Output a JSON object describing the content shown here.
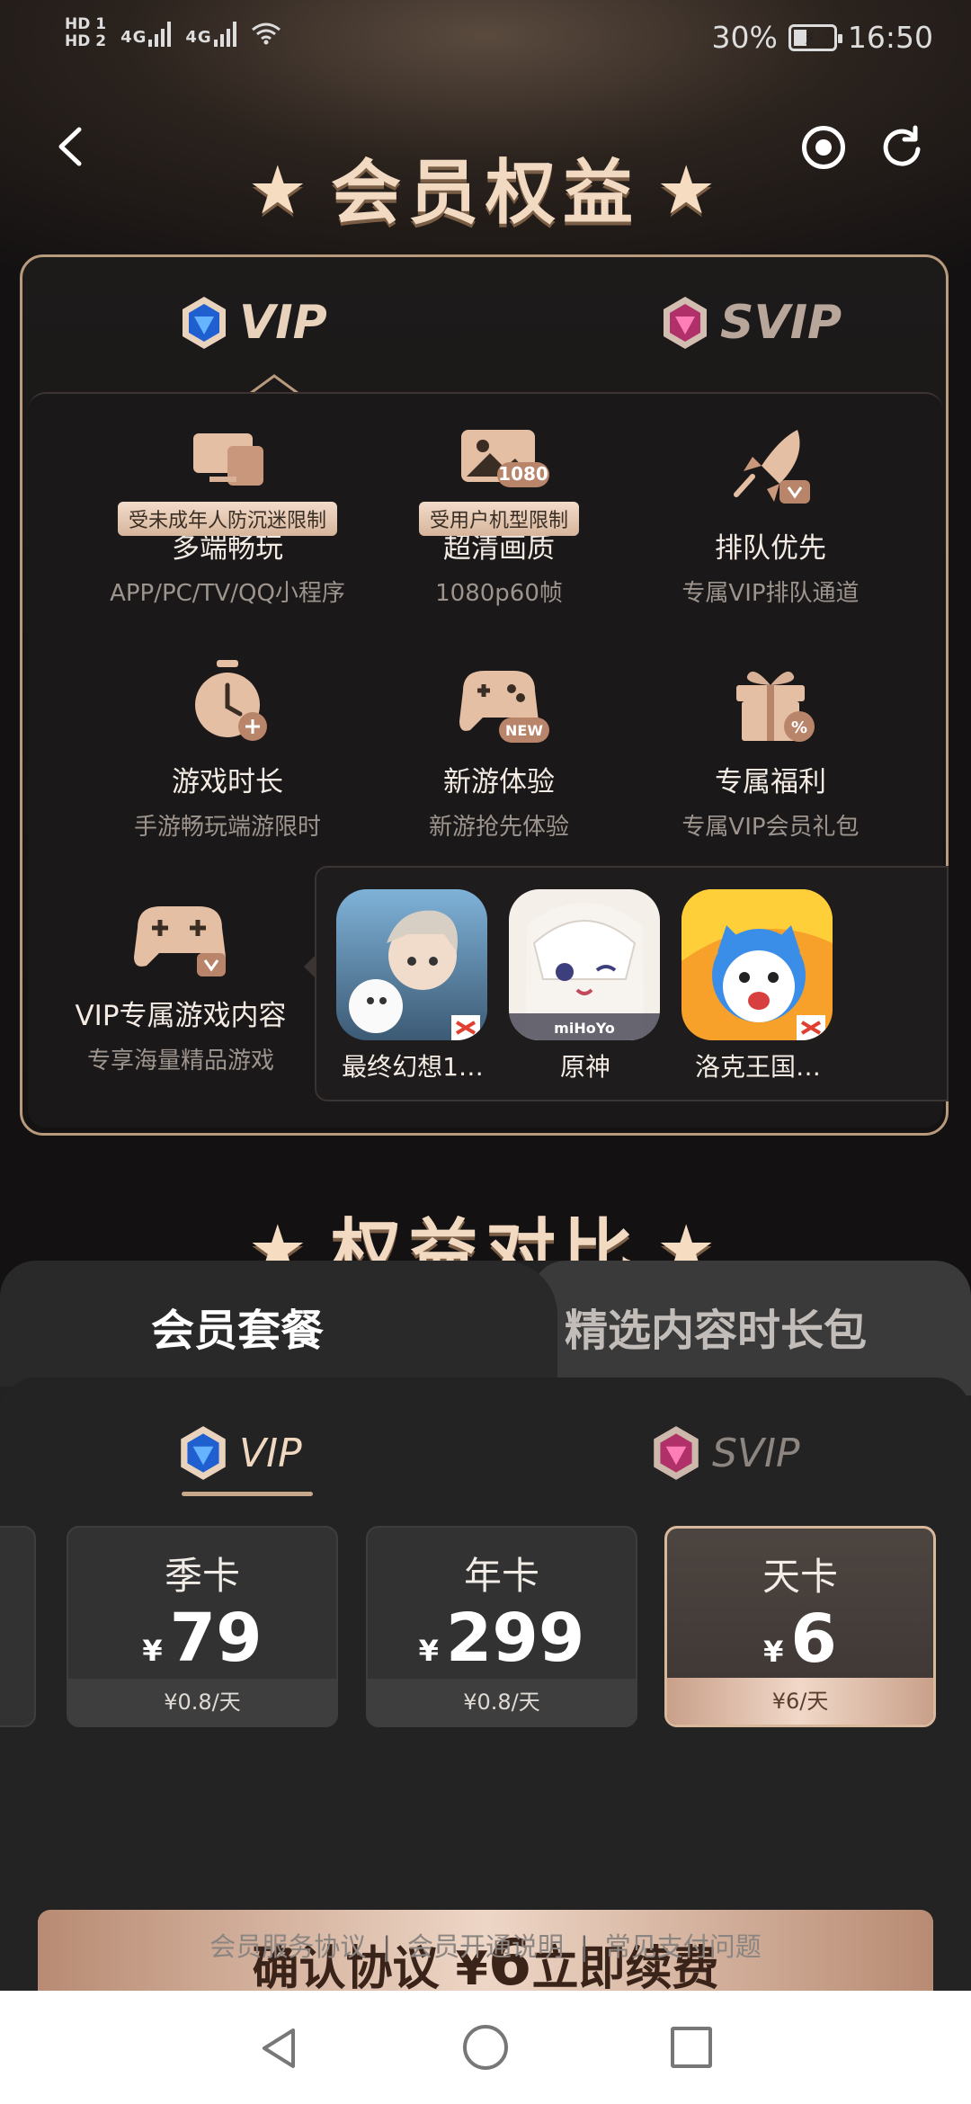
{
  "status_bar": {
    "hd_top": "HD 1",
    "hd_bottom": "HD 2",
    "net1": "4G",
    "net2": "4G",
    "battery": "30%",
    "time": "16:50"
  },
  "header": {
    "title": "会员权益"
  },
  "benefits": {
    "tabs": [
      "VIP",
      "SVIP"
    ],
    "features": [
      {
        "icon": "monitor-icon",
        "tag": "受未成年人防沉迷限制",
        "name": "多端畅玩",
        "desc": "APP/PC/TV/QQ小程序"
      },
      {
        "icon": "image-1080-icon",
        "icon_text": "1080",
        "tag": "受用户机型限制",
        "name": "超清画质",
        "desc": "1080p60帧"
      },
      {
        "icon": "rocket-icon",
        "name": "排队优先",
        "desc": "专属VIP排队通道"
      },
      {
        "icon": "stopwatch-icon",
        "name": "游戏时长",
        "desc": "手游畅玩端游限时"
      },
      {
        "icon": "gamepad-new-icon",
        "icon_text": "NEW",
        "name": "新游体验",
        "desc": "新游抢先体验"
      },
      {
        "icon": "gift-icon",
        "name": "专属福利",
        "desc": "专属VIP会员礼包"
      },
      {
        "icon": "gamepad-vip-icon",
        "name": "VIP专属游戏内容",
        "desc": "专享海量精品游戏"
      }
    ],
    "games": [
      {
        "name": "最终幻想1…",
        "art": "final-fantasy-art"
      },
      {
        "name": "原神",
        "art": "genshin-art",
        "art_text": "miHoYo"
      },
      {
        "name": "洛克王国…",
        "art": "roco-kingdom-art"
      }
    ]
  },
  "comparison": {
    "title": "权益对比"
  },
  "sheet": {
    "tabs": [
      "会员套餐",
      "精选内容时长包"
    ],
    "plan_tabs": [
      "VIP",
      "SVIP"
    ],
    "plans": [
      {
        "name": "季卡",
        "currency": "¥",
        "price": "79",
        "per_day": "¥0.8/天",
        "selected": false
      },
      {
        "name": "年卡",
        "currency": "¥",
        "price": "299",
        "per_day": "¥0.8/天",
        "selected": false
      },
      {
        "name": "天卡",
        "currency": "¥",
        "price": "6",
        "per_day": "¥6/天",
        "selected": true
      }
    ],
    "cta": {
      "prefix": "确认协议 ¥",
      "amount": "6",
      "suffix": "立即续费"
    },
    "links": [
      "会员服务协议",
      "会员开通说明",
      "常见支付问题"
    ],
    "link_separator": "|"
  },
  "colors": {
    "accent": "#d9b89c",
    "gold_text": "#f2d9c2",
    "cta_start": "#b88b73",
    "cta_mid": "#eed6c6"
  }
}
